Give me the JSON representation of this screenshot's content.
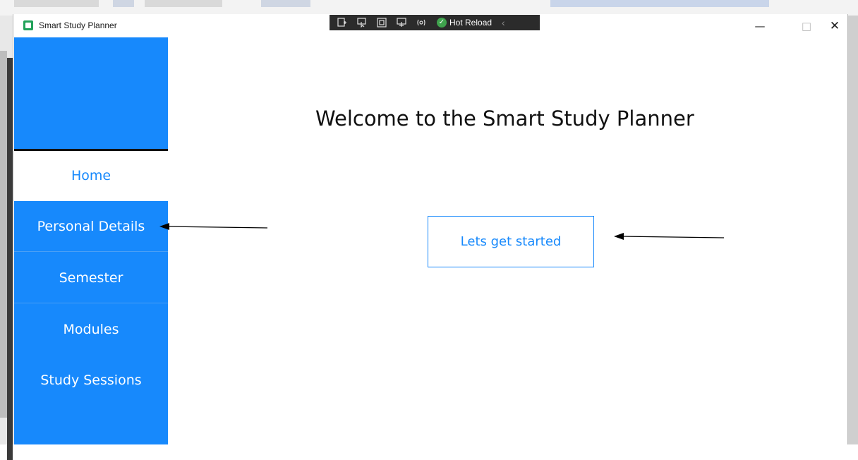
{
  "window": {
    "title": "Smart Study Planner",
    "controls": {
      "minimize": "—",
      "maximize": "□",
      "close": "✕"
    }
  },
  "debug_toolbar": {
    "hot_reload_label": "Hot Reload"
  },
  "sidebar": {
    "items": [
      {
        "label": "Home",
        "selected": true
      },
      {
        "label": "Personal Details",
        "selected": false
      },
      {
        "label": "Semester",
        "selected": false
      },
      {
        "label": "Modules",
        "selected": false
      },
      {
        "label": "Study Sessions",
        "selected": false
      }
    ]
  },
  "main": {
    "title": "Welcome to the Smart Study Planner",
    "start_button_label": "Lets get started"
  },
  "colors": {
    "accent": "#1789fc",
    "sidebar_bg": "#1789fc",
    "selected_bg": "#ffffff",
    "text_dark": "#111111"
  }
}
